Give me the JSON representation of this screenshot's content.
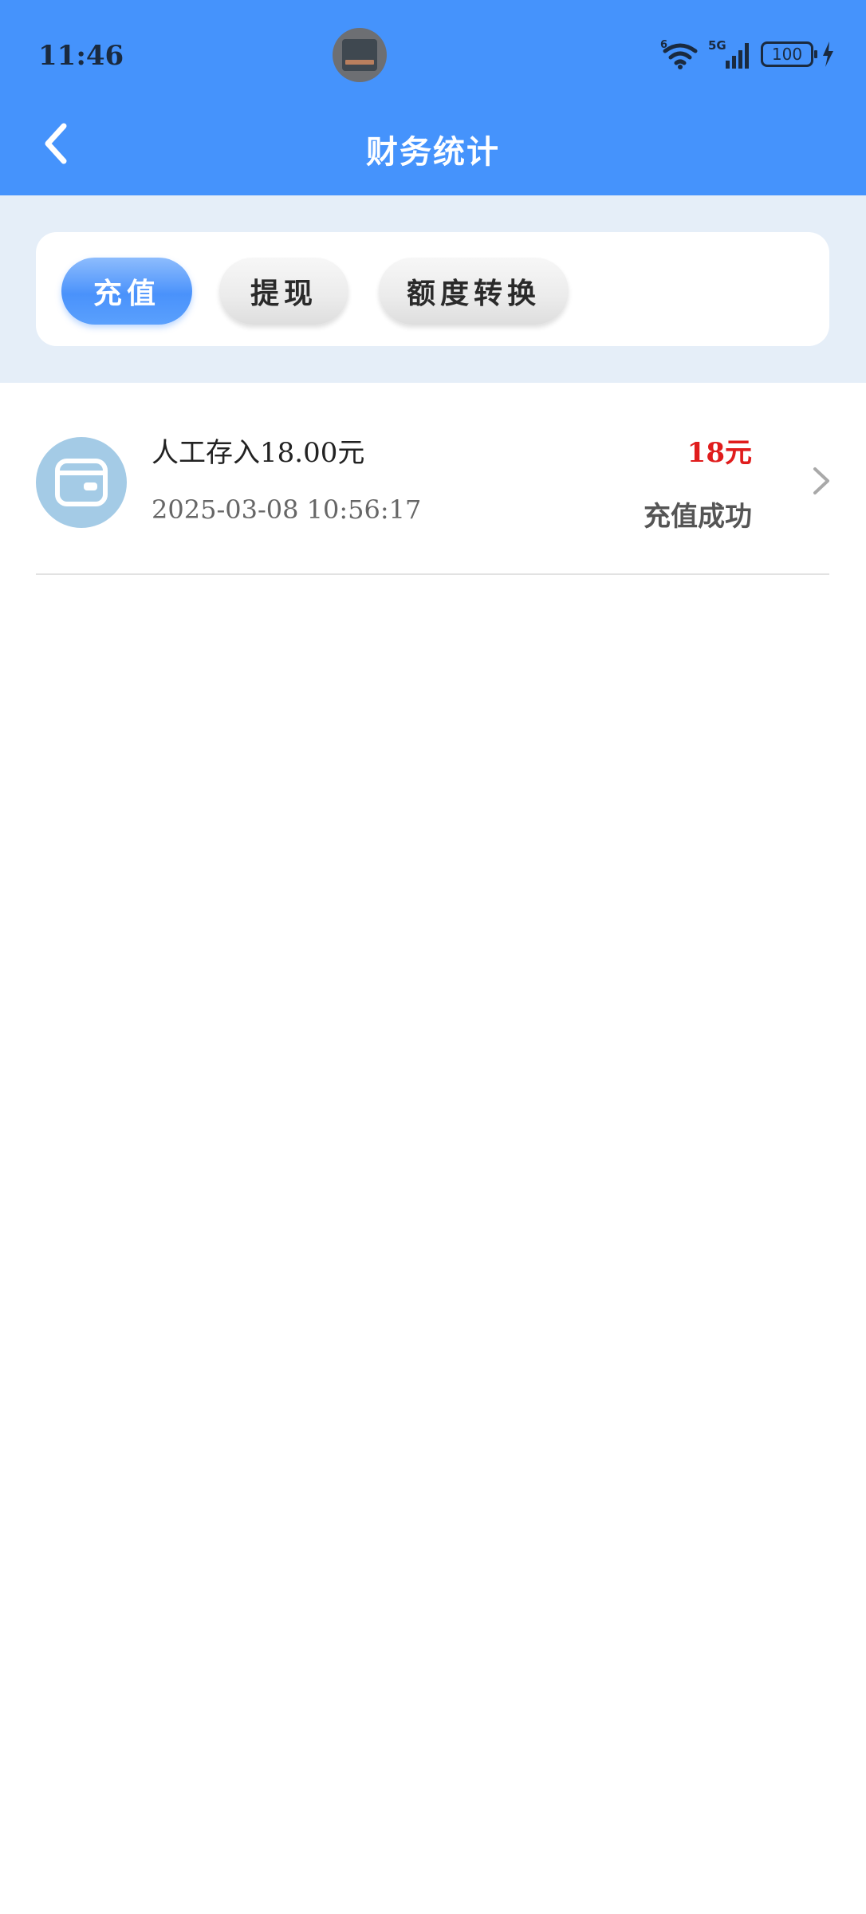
{
  "status_bar": {
    "time": "11:46",
    "network_label": "5G",
    "wifi_badge": "6",
    "battery": "100",
    "icons": [
      "wifi-icon",
      "signal-icon",
      "battery-icon",
      "charging-icon"
    ]
  },
  "nav": {
    "title": "财务统计",
    "back_icon": "chevron-left-icon"
  },
  "tabs": [
    {
      "label": "充值",
      "active": true
    },
    {
      "label": "提现",
      "active": false
    },
    {
      "label": "额度转换",
      "active": false
    }
  ],
  "records": [
    {
      "title": "人工存入18.00元",
      "datetime": "2025-03-08 10:56:17",
      "amount": "18元",
      "status": "充值成功",
      "icon": "wallet-icon"
    }
  ],
  "colors": {
    "header_bg": "#4593fc",
    "tab_area_bg": "#e5eef8",
    "active_tab": "#4a92fb",
    "amount_red": "#e01c1c",
    "icon_circle": "#a4cbe6"
  }
}
